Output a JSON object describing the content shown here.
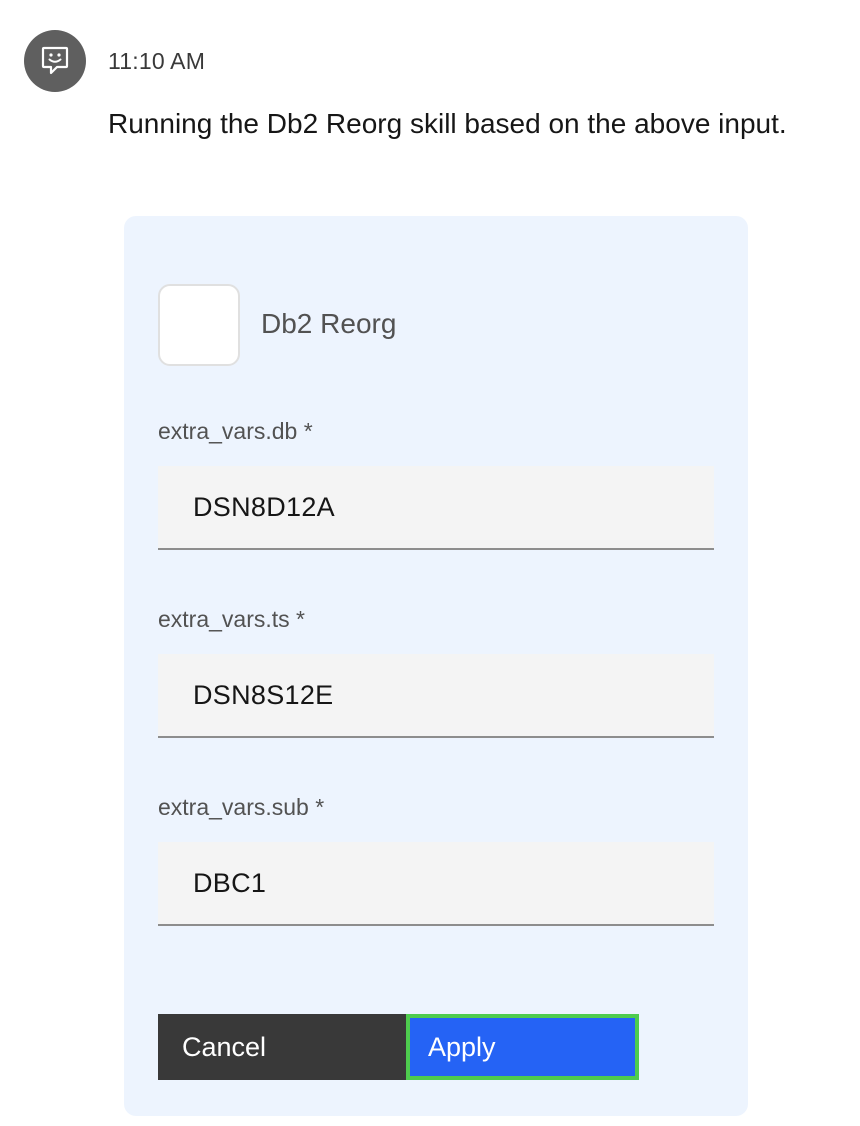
{
  "chat": {
    "avatar_icon": "chat-bot-icon",
    "timestamp": "11:10 AM",
    "message": "Running the Db2 Reorg skill based on the above input."
  },
  "card": {
    "skill_name": "Db2 Reorg",
    "fields": [
      {
        "label": "extra_vars.db *",
        "value": "DSN8D12A"
      },
      {
        "label": "extra_vars.ts *",
        "value": "DSN8S12E"
      },
      {
        "label": "extra_vars.sub *",
        "value": "DBC1"
      }
    ],
    "buttons": {
      "cancel_label": "Cancel",
      "apply_label": "Apply"
    }
  },
  "colors": {
    "card_background": "#edf4fe",
    "cancel_button": "#393939",
    "apply_button": "#2563f5",
    "focus_outline": "#4ecc4e",
    "avatar": "#5f5f5f"
  }
}
